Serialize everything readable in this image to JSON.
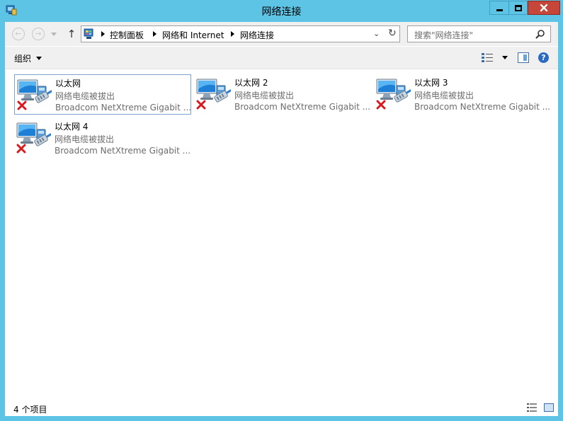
{
  "window": {
    "title": "网络连接",
    "app_icon": "network-connections-icon"
  },
  "caption_buttons": {
    "minimize": "minimize-icon",
    "maximize": "maximize-icon",
    "close": "×"
  },
  "navigation": {
    "back": "←",
    "forward": "→",
    "up": "↑"
  },
  "address": {
    "breadcrumbs": [
      "控制面板",
      "网络和 Internet",
      "网络连接"
    ],
    "dropdown": "⌄",
    "refresh": "↻"
  },
  "search": {
    "placeholder": "搜索\"网络连接\""
  },
  "toolbar": {
    "organize_label": "组织"
  },
  "connections": [
    {
      "name": "以太网",
      "status": "网络电缆被拔出",
      "device": "Broadcom NetXtreme Gigabit ..."
    },
    {
      "name": "以太网 2",
      "status": "网络电缆被拔出",
      "device": "Broadcom NetXtreme Gigabit ..."
    },
    {
      "name": "以太网 3",
      "status": "网络电缆被拔出",
      "device": "Broadcom NetXtreme Gigabit ..."
    },
    {
      "name": "以太网 4",
      "status": "网络电缆被拔出",
      "device": "Broadcom NetXtreme Gigabit ..."
    }
  ],
  "statusbar": {
    "count": "4 个项目"
  },
  "colors": {
    "frame": "#5ec4e6",
    "close_button": "#c7463a",
    "disconnected_x": "#d9191e",
    "selection_border": "#7da2ce"
  }
}
